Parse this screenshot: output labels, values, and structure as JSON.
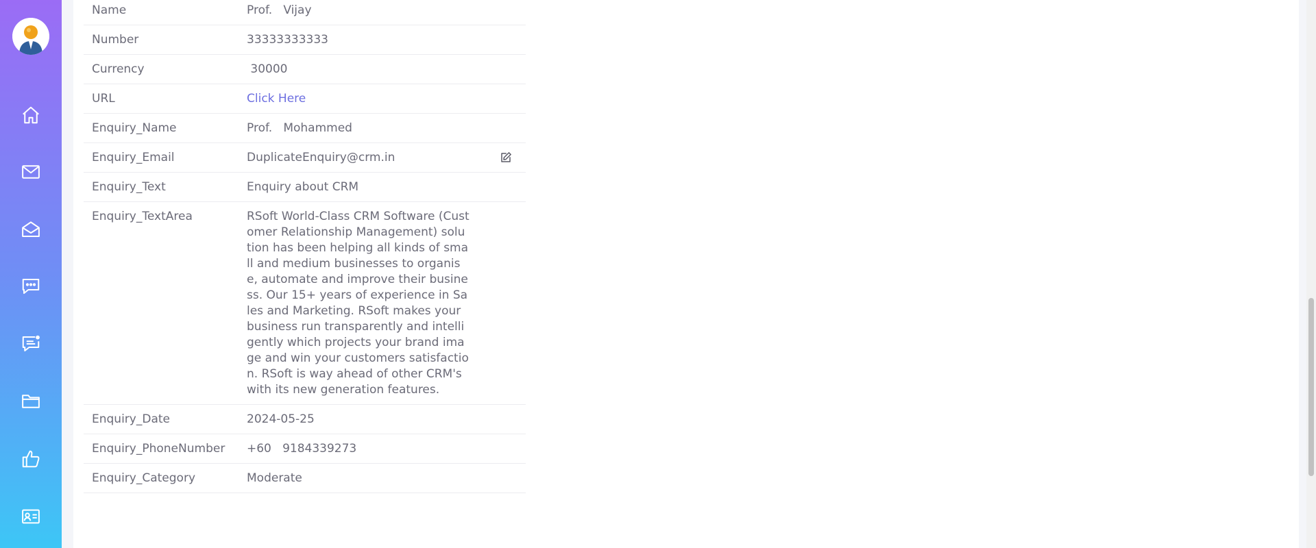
{
  "sidebar": {
    "avatar": "user-avatar",
    "items": [
      {
        "name": "home",
        "icon": "home-icon"
      },
      {
        "name": "mail",
        "icon": "mail-icon"
      },
      {
        "name": "mail-open",
        "icon": "mail-open-icon"
      },
      {
        "name": "chat",
        "icon": "chat-icon"
      },
      {
        "name": "notification-chat",
        "icon": "chat-notification-icon"
      },
      {
        "name": "folder",
        "icon": "folder-icon"
      },
      {
        "name": "thumbs-up",
        "icon": "thumbs-up-icon"
      },
      {
        "name": "contact-card",
        "icon": "contact-card-icon"
      }
    ]
  },
  "details": {
    "rows": [
      {
        "label": "Name",
        "value": "Prof.   Vijay"
      },
      {
        "label": "Number",
        "value": "33333333333"
      },
      {
        "label": "Currency",
        "value": " 30000"
      },
      {
        "label": "URL",
        "value": "Click Here"
      },
      {
        "label": "Enquiry_Name",
        "value": "Prof.   Mohammed"
      },
      {
        "label": "Enquiry_Email",
        "value": "DuplicateEnquiry@crm.in"
      },
      {
        "label": "Enquiry_Text",
        "value": "Enquiry about CRM"
      },
      {
        "label": "Enquiry_TextArea",
        "value": "RSoft World-Class CRM Software (Customer Relationship Management) solution has been helping all kinds of small and medium businesses to organise, automate and improve their business. Our 15+ years of experience in Sales and Marketing. RSoft makes your business run transparently and intelligently which projects your brand image and win your customers satisfaction. RSoft is way ahead of other CRM's with its new generation features."
      },
      {
        "label": "Enquiry_Date",
        "value": "2024-05-25"
      },
      {
        "label": "Enquiry_PhoneNumber",
        "value": "+60   9184339273"
      },
      {
        "label": "Enquiry_Category",
        "value": "Moderate"
      }
    ]
  },
  "colors": {
    "sidebar_top": "#9b6cf5",
    "sidebar_bottom": "#3dc6f6",
    "link": "#6d6fe0",
    "text": "#6b6b78"
  }
}
